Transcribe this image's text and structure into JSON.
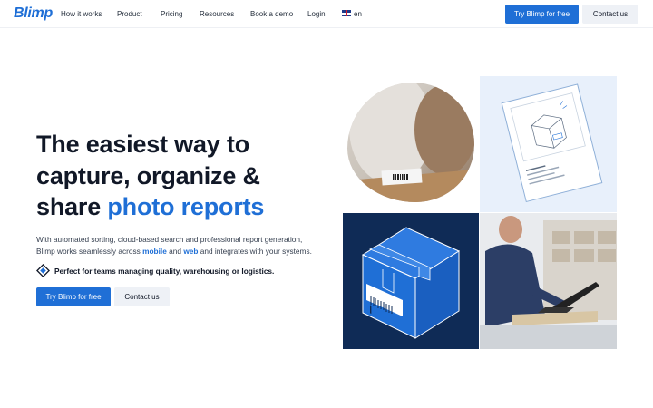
{
  "nav": {
    "logo": "Blimp",
    "links": [
      "How it works",
      "Product",
      "Pricing",
      "Resources",
      "Book a demo",
      "Login"
    ],
    "language": "en",
    "try_button": "Try Blimp for free",
    "contact_button": "Contact us"
  },
  "hero": {
    "headline_line1": "The easiest way to",
    "headline_line2": "capture, organize &",
    "headline_line3_start": "share ",
    "headline_line3_accent": "photo reports",
    "desc_line1": "With automated sorting, cloud-based search and professional report generation,",
    "desc_line2_start": "Blimp works seamlessly across ",
    "desc_mobile": "mobile",
    "desc_and": " and ",
    "desc_web": "web",
    "desc_line2_end": " and integrates with your systems.",
    "perfect_for": "Perfect for teams managing quality, warehousing or logistics.",
    "try_button": "Try Blimp for free",
    "contact_button": "Contact us"
  },
  "colors": {
    "accent": "#1f6fd6",
    "dark_navy": "#0f2b56",
    "light_blue": "#e8f0fb"
  }
}
